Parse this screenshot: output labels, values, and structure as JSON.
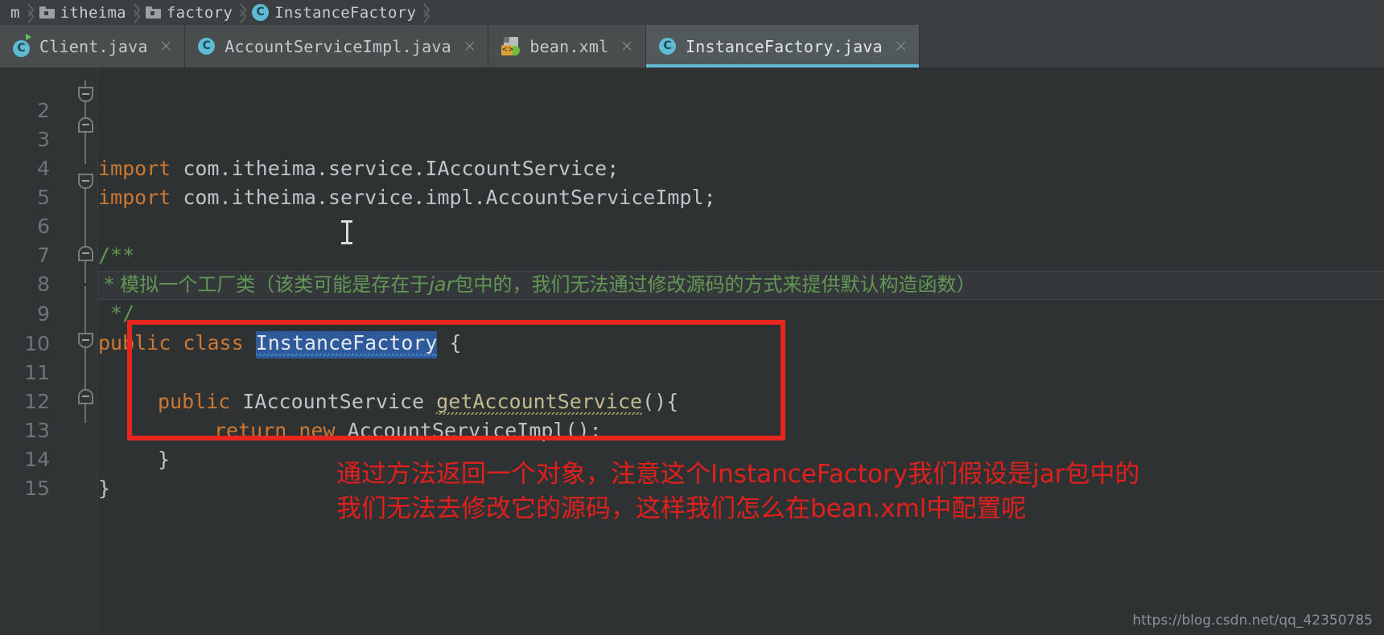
{
  "breadcrumb": {
    "name": "breadcrumb",
    "items": [
      {
        "label": "m",
        "icon": "truncated-text",
        "type": "text"
      },
      {
        "label": "itheima",
        "icon": "folder-icon",
        "type": "folder"
      },
      {
        "label": "factory",
        "icon": "folder-icon",
        "type": "folder"
      },
      {
        "label": "InstanceFactory",
        "icon": "java-class-icon",
        "type": "class"
      }
    ]
  },
  "tabs": [
    {
      "label": "Client.java",
      "icon": "java-class-icon",
      "close": "×",
      "active": false,
      "runnable": true
    },
    {
      "label": "AccountServiceImpl.java",
      "icon": "java-class-icon",
      "close": "×",
      "active": false,
      "runnable": false
    },
    {
      "label": "bean.xml",
      "icon": "xml-file-icon",
      "close": "×",
      "active": false,
      "runnable": false
    },
    {
      "label": "InstanceFactory.java",
      "icon": "java-class-icon",
      "close": "×",
      "active": true,
      "runnable": false
    }
  ],
  "editor": {
    "line_numbers": [
      "2",
      "3",
      "4",
      "5",
      "6",
      "7",
      "8",
      "9",
      "10",
      "11",
      "12",
      "13",
      "14",
      "15"
    ],
    "code": {
      "l3_kw": "import",
      "l3_rest": " com.itheima.service.IAccountService;",
      "l4_kw": "import",
      "l4_rest": " com.itheima.service.impl.AccountServiceImpl;",
      "l6": "/**",
      "l7": " * 模拟一个工厂类（该类可能是存在于",
      "l7_italic": "jar",
      "l7_tail": "包中的，我们无法通过修改源码的方式来提供默认构造函数）",
      "l8": " */",
      "l9_kw1": "public",
      "l9_kw2": "class",
      "l9_name": "InstanceFactory",
      "l9_brace": "{",
      "l11_kw": "public",
      "l11_type": "IAccountService",
      "l11_method": "getAccountService",
      "l11_tail": "(){",
      "l12_kw1": "return",
      "l12_kw2": "new",
      "l12_call": "AccountServiceImpl();",
      "l13": "}",
      "l14": "}"
    }
  },
  "annotation": {
    "line1": "通过方法返回一个对象，注意这个InstanceFactory我们假设是jar包中的",
    "line2": "我们无法去修改它的源码，这样我们怎么在bean.xml中配置呢"
  },
  "watermark": "https://blog.csdn.net/qq_42350785",
  "colors": {
    "editor_bg": "#2f3233",
    "chrome_bg": "#3c3f41",
    "active_tab_underline": "#5fbbd4",
    "annotation_red": "#e0201c",
    "keyword_orange": "#cc7832",
    "comment_green": "#629755",
    "method_tan": "#c0bb8f",
    "selection_blue": "#2e5a9c"
  }
}
